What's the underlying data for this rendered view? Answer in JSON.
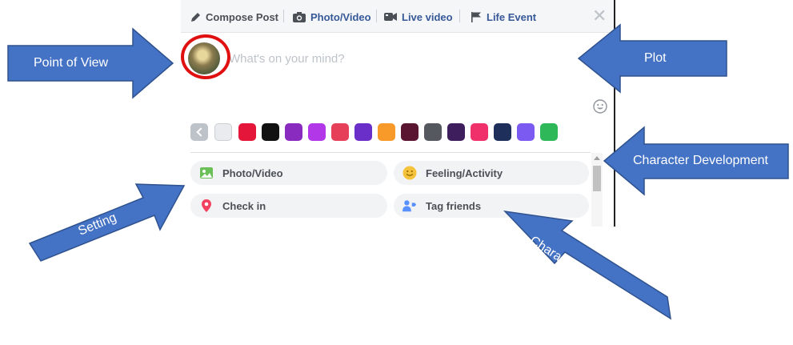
{
  "composer": {
    "tabs": [
      {
        "label": "Compose Post"
      },
      {
        "label": "Photo/Video"
      },
      {
        "label": "Live video"
      },
      {
        "label": "Life Event"
      }
    ],
    "placeholder": "What's on your mind?",
    "background_swatches": [
      "#e9ebee",
      "#e4173a",
      "#111111",
      "#8a2bbf",
      "#b237e8",
      "#e63f5a",
      "#6b2fc9",
      "#f79a2a",
      "#5a1630",
      "#55585f",
      "#3e1e5c",
      "#f0306a",
      "#1e2f5c",
      "#7a5af0",
      "#2fb85a"
    ],
    "actions": [
      {
        "label": "Photo/Video",
        "icon": "photo-icon",
        "color": "#6bbf59"
      },
      {
        "label": "Feeling/Activity",
        "icon": "smiley-icon",
        "color": "#f5c33b"
      },
      {
        "label": "Check in",
        "icon": "location-pin-icon",
        "color": "#f3425f"
      },
      {
        "label": "Tag friends",
        "icon": "tag-friends-icon",
        "color": "#5890ff"
      }
    ]
  },
  "annotations": {
    "point_of_view": "Point of View",
    "plot": "Plot",
    "character_development": "Character Development",
    "setting": "Setting",
    "characters_or_audience": "Characters or Audience"
  },
  "colors": {
    "arrow_fill": "#4472c4",
    "arrow_stroke": "#2f528f",
    "highlight_ring": "#e01010"
  }
}
